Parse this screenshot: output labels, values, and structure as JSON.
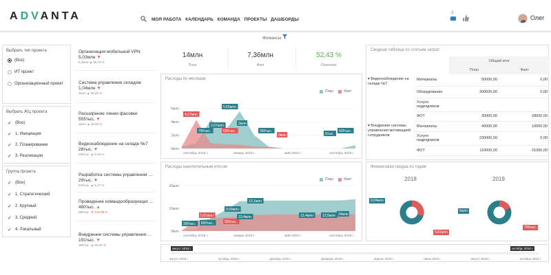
{
  "header": {
    "logo_left": "A",
    "logo_mid": "DV",
    "logo_right": "ANTA",
    "nav": [
      "МОЯ РАБОТА",
      "КАЛЕНДАРЬ",
      "КОМАНДА",
      "ПРОЕКТЫ",
      "ДАШБОРДЫ"
    ],
    "notif_count": "2",
    "user_name": "Олег"
  },
  "page_title": "Финансы",
  "filters": {
    "project_type_label": "Выбрать тип проекта",
    "project_type_options": [
      "(Все)",
      "ИТ проект",
      "Организационный проект"
    ],
    "stage_label": "Выбрать ЖЦ проекта",
    "stage_options": [
      "(Все)",
      "1. Инициация",
      "2. Планирование",
      "3. Реализация"
    ],
    "group_label": "Группа проекта",
    "group_options": [
      "(Все)",
      "1. Стратегический",
      "2. Крупный",
      "3. Средний",
      "4. Локальный"
    ]
  },
  "projects": [
    {
      "name": "Организация мобильной VPN",
      "value": "5,03млн",
      "sub": "5,2млн",
      "pct": "96,79 %"
    },
    {
      "name": "Система управления складом",
      "value": "1,04млн",
      "sub": "4млн",
      "pct": "26,00 %"
    },
    {
      "name": "Расширение линии фасовки",
      "value": "555тыс.",
      "sub": "3млн",
      "pct": "18,50 %"
    },
    {
      "name": "Видеонаблюдение на складе №7",
      "value": "28тыс.",
      "sub": "330тыс.",
      "pct": "8,48 %"
    },
    {
      "name": "Разработка системы управления и ...",
      "value": "29тыс.",
      "sub": "530тыс.",
      "pct": "5,47 %"
    },
    {
      "name": "Проведение командообразующего ...",
      "value": "480тыс.",
      "sub": "390тыс.",
      "pct": "123,08 %"
    },
    {
      "name": "Внедрение системы управления мо...",
      "value": "191тыс.",
      "sub": "380тыс.",
      "pct": "50,26 %"
    }
  ],
  "kpis": [
    {
      "value": "14млн",
      "label": "План"
    },
    {
      "value": "7,36млн",
      "label": "Факт"
    },
    {
      "value": "52,43 %",
      "label": "Освоение"
    }
  ],
  "colors": {
    "plan": "#8fc5c6",
    "fact": "#e88a8a",
    "teal_label": "#2a7f8a",
    "red_label": "#e05a5a",
    "accent_green": "#4caf50"
  },
  "monthly": {
    "title": "Расходы по месяцам",
    "legend_plan": "План",
    "legend_fact": "Факт",
    "yticks": [
      "6млн",
      "4млн",
      "2млн",
      "0млн"
    ],
    "xticks": [
      "сентябрь 2018 г.",
      "январь 2019 г.",
      "май 2019 г.",
      "сентябрь 2019 г."
    ],
    "labels": [
      "4,27млн",
      "5,55млн",
      "2,67млн",
      "790тыс.",
      "2млн",
      "555тыс.",
      "300тыс.",
      "0млн",
      "5тыс.",
      "500тыс."
    ]
  },
  "cumulative": {
    "title": "Расходы накопительным итогом",
    "legend_plan": "План",
    "legend_fact": "Факт",
    "yticks": [
      "20млн",
      "10млн",
      "0млн"
    ],
    "xticks": [
      "сентябрь 2018 г.",
      "январь 2019 г.",
      "май 2019 г.",
      "сентябрь 2019 г."
    ],
    "labels": [
      "5,81млн",
      "9,04млн",
      "13,1млн",
      "300тыс.",
      "820тыс.",
      "555тыс.",
      "13,4млн",
      "13,4млн",
      "13,5млн",
      "14млн"
    ]
  },
  "chart_data": [
    {
      "type": "area",
      "title": "Расходы по месяцам",
      "series": [
        {
          "name": "План",
          "values": [
            0.3,
            0.8,
            4.27,
            2.67,
            5.55,
            2,
            0.3,
            0,
            0,
            0,
            0,
            0.005,
            0.5
          ]
        },
        {
          "name": "Факт",
          "values": [
            0.3,
            4.27,
            0.79,
            0.6,
            0.555,
            0.3,
            0.2,
            0,
            0,
            0,
            0,
            0,
            0
          ]
        }
      ],
      "ylim": [
        0,
        8
      ]
    },
    {
      "type": "area",
      "title": "Расходы накопительным итогом",
      "series": [
        {
          "name": "План",
          "values": [
            0.3,
            0.82,
            5.81,
            9.04,
            13.1,
            13.4,
            13.4,
            13.4,
            13.4,
            13.4,
            13.5,
            13.5,
            14
          ]
        },
        {
          "name": "Факт",
          "values": [
            0.3,
            4.6,
            5.4,
            6.0,
            6.6,
            7.0,
            7.2,
            7.3,
            7.3,
            7.36,
            7.36,
            7.36,
            7.36
          ]
        }
      ],
      "ylim": [
        0,
        20
      ]
    }
  ],
  "pivot": {
    "title": "Сводная таблица по статьям затрат",
    "total_header": "Общий итог",
    "col_plan": "План",
    "col_fact": "Факт",
    "groups": [
      {
        "name": "Видеонаблюдение на складе №7",
        "rows": [
          {
            "item": "Материалы",
            "plan": "50000,00",
            "fact": "0,00"
          },
          {
            "item": "Оборудование",
            "plan": "300000,00",
            "fact": "0,00"
          },
          {
            "item": "Услуги подрядчиков",
            "plan": "",
            "fact": ""
          },
          {
            "item": "ФОТ",
            "plan": "30000,00",
            "fact": "28000,00"
          }
        ]
      },
      {
        "name": "Внедрение системы управления мотивацией сотрудников",
        "rows": [
          {
            "item": "Материалы",
            "plan": "40000,00",
            "fact": "10000,00"
          },
          {
            "item": "Услуги подрядчиков",
            "plan": "230000,00",
            "fact": "0,00"
          },
          {
            "item": "ФОТ",
            "plan": "110000,00",
            "fact": "31000,00"
          }
        ]
      }
    ]
  },
  "fin_summary": {
    "title": "Финансовая сводка по годам",
    "years": [
      {
        "year": "2018",
        "plan": "9,04млн",
        "fact": "6,81млн"
      },
      {
        "year": "2019",
        "plan": "5млн",
        "fact": "750тыс."
      }
    ]
  },
  "timeline": {
    "start": "август 2018 г.",
    "end": "октябрь 2019 г.",
    "ticks": [
      "август 2018 г.",
      "октябрь 2018 г.",
      "декабрь 2018 г.",
      "февраль 2019 г.",
      "апрель 2019 г.",
      "июнь 2019 г.",
      "август 2019 г.",
      "октябрь 2019 г."
    ]
  }
}
